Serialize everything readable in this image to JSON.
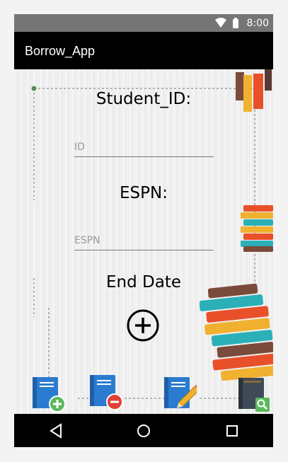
{
  "status_bar": {
    "time": "8:00",
    "wifi_icon": "wifi-icon",
    "battery_icon": "battery-icon"
  },
  "app_bar": {
    "title": "Borrow_App"
  },
  "form": {
    "student_id_label": "Student_ID:",
    "student_id_placeholder": "ID",
    "espn_label": "ESPN:",
    "espn_placeholder": "ESPN",
    "end_date_label": "End Date",
    "add_date_icon": "plus-circle-icon"
  },
  "bottom_actions": [
    {
      "icon": "book-add-icon"
    },
    {
      "icon": "book-remove-icon"
    },
    {
      "icon": "book-edit-icon"
    },
    {
      "icon": "book-search-icon"
    }
  ],
  "nav_bar": {
    "back_icon": "back-triangle-icon",
    "home_icon": "home-circle-icon",
    "recents_icon": "recents-square-icon"
  },
  "colors": {
    "status_bar": "#757575",
    "app_bar": "#000000",
    "book_blue": "#2b7bd0",
    "plus_green": "#5cb85c",
    "minus_red": "#e0403a"
  }
}
